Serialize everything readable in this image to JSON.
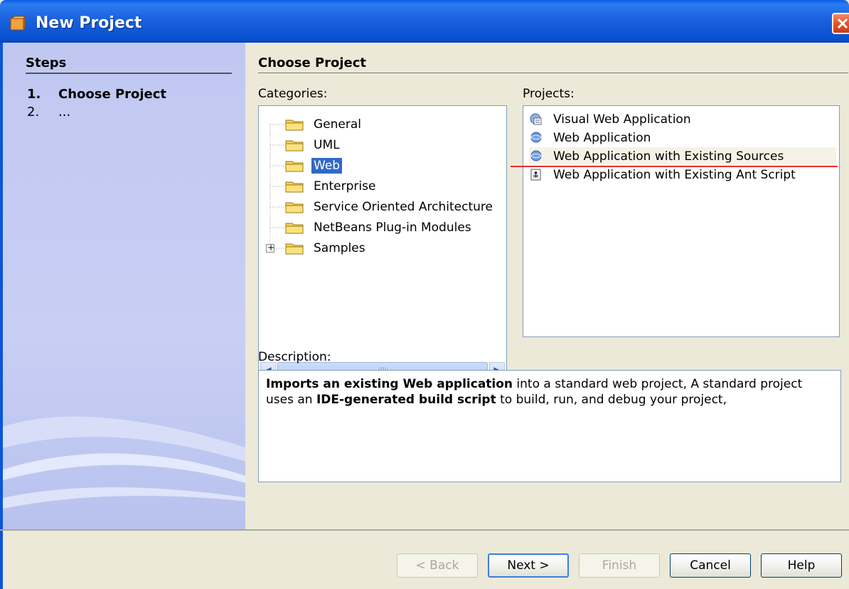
{
  "window": {
    "title": "New Project"
  },
  "steps": {
    "title": "Steps",
    "items": [
      {
        "number": "1.",
        "label": "Choose Project"
      },
      {
        "number": "2.",
        "label": "..."
      }
    ]
  },
  "main": {
    "title": "Choose Project",
    "categories_label": "Categories:",
    "projects_label": "Projects:",
    "description_label": "Description:",
    "categories": [
      {
        "label": "General",
        "selected": false
      },
      {
        "label": "UML",
        "selected": false
      },
      {
        "label": "Web",
        "selected": true
      },
      {
        "label": "Enterprise",
        "selected": false
      },
      {
        "label": "Service Oriented Architecture",
        "selected": false
      },
      {
        "label": "NetBeans Plug-in Modules",
        "selected": false
      },
      {
        "label": "Samples",
        "selected": false,
        "expandable": true
      }
    ],
    "projects": [
      {
        "label": "Visual Web Application",
        "icon": "visual-web-icon"
      },
      {
        "label": "Web Application",
        "icon": "globe-icon"
      },
      {
        "label": "Web Application with Existing Sources",
        "icon": "globe-icon",
        "highlighted": true
      },
      {
        "label": "Web Application with Existing Ant Script",
        "icon": "ant-script-icon"
      }
    ],
    "description": {
      "bold1": "Imports an existing Web application",
      "text1": " into a standard web project, A standard project uses an ",
      "bold2": "IDE-generated build script",
      "text2": " to build, run, and debug your project,"
    }
  },
  "buttons": {
    "back": "< Back",
    "next": "Next >",
    "finish": "Finish",
    "cancel": "Cancel",
    "help": "Help"
  },
  "colors": {
    "titlebar": "#0a5ee6",
    "selection": "#316ac5",
    "annotation_underline": "#e53030"
  }
}
